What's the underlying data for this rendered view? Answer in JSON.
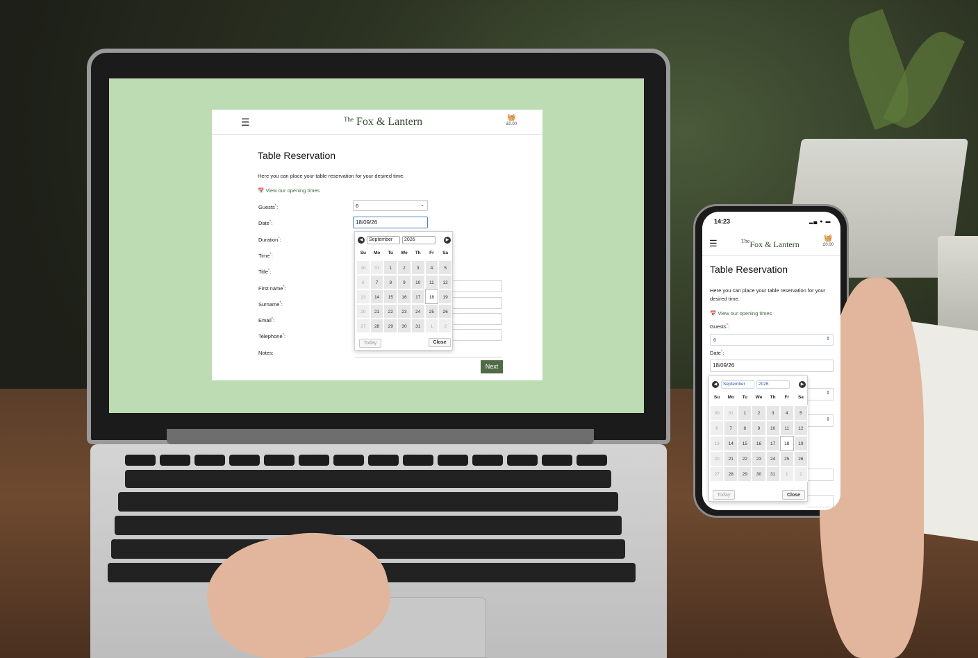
{
  "site": {
    "logo_prefix": "The",
    "logo_name": "Fox & Lantern",
    "menu_icon": "☰",
    "basket_icon": "basket-icon",
    "basket_amount": "£0.00"
  },
  "form": {
    "title": "Table Reservation",
    "intro": "Here you can place your table reservation for your desired time.",
    "opening_times_link": "View our opening times",
    "required_mark": "*",
    "labels": {
      "guests": "Guests",
      "date": "Date",
      "duration": "Duration",
      "time": "Time",
      "title": "Title",
      "first_name": "First name",
      "surname": "Surname",
      "email": "Email",
      "telephone": "Telephone",
      "notes": "Notes:"
    },
    "guests_value": "6",
    "date_value": "18/09/26",
    "next_label": "Next"
  },
  "datepicker": {
    "month": "September",
    "year": "2026",
    "weekdays": [
      "Su",
      "Mo",
      "Tu",
      "We",
      "Th",
      "Fr",
      "Sa"
    ],
    "weeks": [
      [
        "30",
        "31",
        "1",
        "2",
        "3",
        "4",
        "5"
      ],
      [
        "6",
        "7",
        "8",
        "9",
        "10",
        "11",
        "12"
      ],
      [
        "13",
        "14",
        "15",
        "16",
        "17",
        "18",
        "19"
      ],
      [
        "20",
        "21",
        "22",
        "23",
        "24",
        "25",
        "26"
      ],
      [
        "27",
        "28",
        "29",
        "30",
        "31",
        "1",
        "2"
      ]
    ],
    "selected_day": "18",
    "today_label": "Today",
    "close_label": "Close"
  },
  "phone": {
    "status_time": "14:23"
  }
}
